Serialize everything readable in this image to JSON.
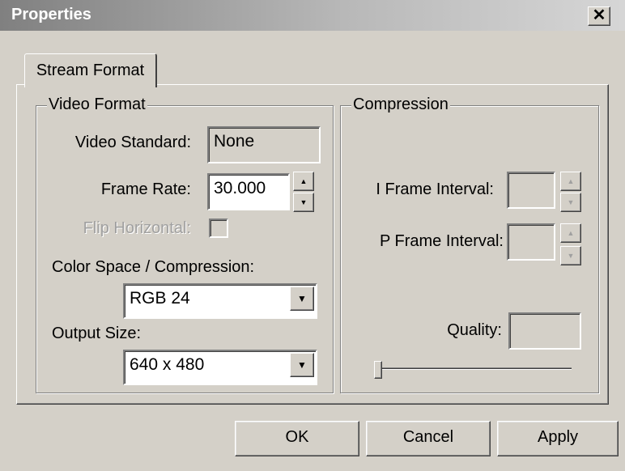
{
  "window": {
    "title": "Properties",
    "close_glyph": "✕"
  },
  "tabs": [
    {
      "label": "Stream Format",
      "active": true
    }
  ],
  "video_format": {
    "legend": "Video Format",
    "video_standard": {
      "label": "Video Standard:",
      "value": "None"
    },
    "frame_rate": {
      "label": "Frame Rate:",
      "value": "30.000"
    },
    "flip_horizontal": {
      "label": "Flip Horizontal:",
      "checked": false,
      "enabled": false
    },
    "color_space": {
      "label": "Color Space / Compression:",
      "selected": "RGB 24"
    },
    "output_size": {
      "label": "Output Size:",
      "selected": "640 x 480"
    }
  },
  "compression": {
    "legend": "Compression",
    "i_frame_interval": {
      "label": "I Frame Interval:",
      "value": ""
    },
    "p_frame_interval": {
      "label": "P Frame Interval:",
      "value": ""
    },
    "quality": {
      "label": "Quality:",
      "value": "",
      "slider_fraction": 0.0
    }
  },
  "buttons": {
    "ok": "OK",
    "cancel": "Cancel",
    "apply": "Apply"
  },
  "icons": {
    "spin_up": "▲",
    "spin_down": "▼",
    "dropdown": "▼"
  }
}
